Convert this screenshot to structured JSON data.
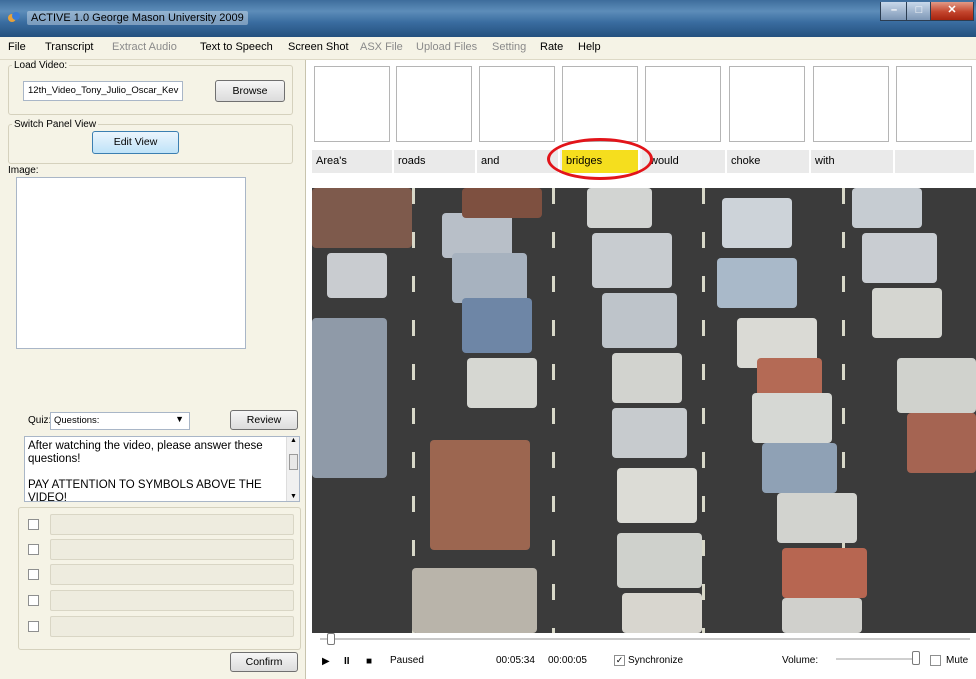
{
  "window": {
    "title": "ACTIVE 1.0 George Mason University 2009"
  },
  "menu": [
    "File",
    "Transcript",
    "Extract Audio",
    "Text to Speech",
    "Screen Shot",
    "ASX File",
    "Upload Files",
    "Setting",
    "Rate",
    "Help"
  ],
  "load_video": {
    "label": "Load Video:",
    "value": "12th_Video_Tony_Julio_Oscar_Kev",
    "browse": "Browse"
  },
  "switch_panel": {
    "label": "Switch Panel View",
    "button": "Edit View"
  },
  "image_label": "Image:",
  "quiz": {
    "label": "Quiz:",
    "selected": "Questions:",
    "review": "Review",
    "text": "After watching the video, please answer these questions!\n\nPAY ATTENTION TO SYMBOLS ABOVE THE VIDEO!"
  },
  "confirm": "Confirm",
  "words": [
    "Area's",
    "roads",
    "and",
    "bridges",
    "would",
    "choke",
    "with",
    ""
  ],
  "player": {
    "status": "Paused",
    "position": "00:05:34",
    "duration": "00:00:05",
    "sync": "Synchronize",
    "volume": "Volume:",
    "mute": "Mute"
  },
  "colors": {
    "highlight": "#f5de1e",
    "circle": "#e2141a"
  }
}
